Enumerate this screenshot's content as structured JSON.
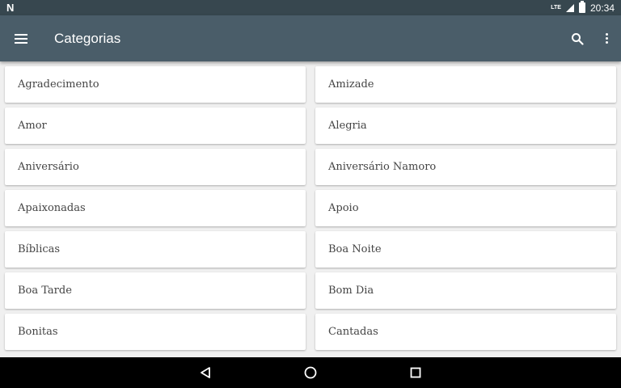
{
  "status_bar": {
    "network_type": "LTE",
    "time": "20:34"
  },
  "app_bar": {
    "title": "Categorias",
    "icons": [
      "menu-icon",
      "search-icon",
      "more-vert-icon"
    ]
  },
  "categories": [
    "Agradecimento",
    "Amizade",
    "Amor",
    "Alegria",
    "Aniversário",
    "Aniversário Namoro",
    "Apaixonadas",
    "Apoio",
    "Bíblicas",
    "Boa Noite",
    "Boa Tarde",
    "Bom Dia",
    "Bonitas",
    "Cantadas"
  ],
  "nav_bar": {
    "icons": [
      "back-icon",
      "home-icon",
      "recents-icon"
    ]
  },
  "colors": {
    "status_bar": "#37474f",
    "app_bar": "#4a5d69",
    "background": "#f0f0f0",
    "card": "#ffffff"
  }
}
